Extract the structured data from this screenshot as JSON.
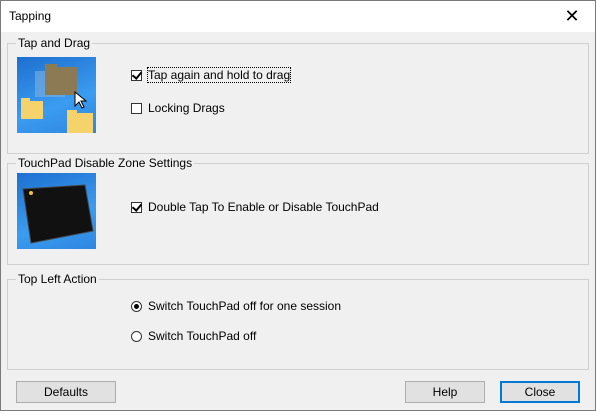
{
  "window": {
    "title": "Tapping",
    "close_glyph": "✕"
  },
  "tap_and_drag": {
    "legend": "Tap and Drag",
    "tap_hold_label": "Tap again and hold to drag",
    "tap_hold_checked": true,
    "locking_label": "Locking Drags",
    "locking_checked": false
  },
  "disable_zone": {
    "legend": "TouchPad Disable Zone Settings",
    "double_tap_label": "Double Tap To Enable or Disable TouchPad",
    "double_tap_checked": true
  },
  "top_left_action": {
    "legend": "Top Left Action",
    "options": [
      {
        "label": "Switch TouchPad off for one session",
        "selected": true
      },
      {
        "label": "Switch TouchPad off",
        "selected": false
      }
    ]
  },
  "buttons": {
    "defaults": "Defaults",
    "help": "Help",
    "close": "Close"
  },
  "colors": {
    "thumb_blue": "#2f86e0",
    "focus_blue": "#0078d7"
  }
}
